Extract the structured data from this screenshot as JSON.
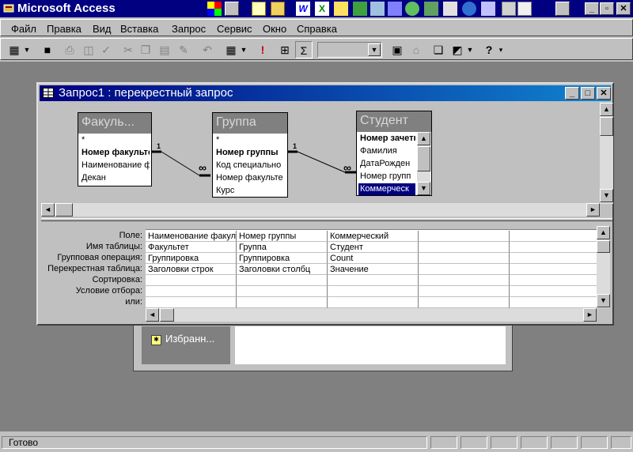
{
  "app": {
    "title": "Microsoft Access"
  },
  "menu": [
    "Файл",
    "Правка",
    "Вид",
    "Вставка",
    "Запрос",
    "Сервис",
    "Окно",
    "Справка"
  ],
  "query_window": {
    "title": "Запрос1 : перекрестный запрос",
    "tables": [
      {
        "name": "Факуль...",
        "fields": [
          "*",
          "Номер факульте",
          "Наименование ф",
          "Декан"
        ]
      },
      {
        "name": "Группа",
        "fields": [
          "*",
          "Номер группы",
          "Код специально",
          "Номер факульте",
          "Курс"
        ]
      },
      {
        "name": "Студент",
        "fields": [
          "Номер зачетн",
          "Фамилия",
          "ДатаРожден",
          "Номер групп",
          "Коммерческ"
        ]
      }
    ],
    "relations": [
      {
        "one": "1",
        "many": "∞"
      },
      {
        "one": "1",
        "many": "∞"
      }
    ],
    "grid_labels": [
      "Поле:",
      "Имя таблицы:",
      "Групповая операция:",
      "Перекрестная таблица:",
      "Сортировка:",
      "Условие отбора:",
      "или:"
    ],
    "grid_columns": [
      [
        "Наименование факуль",
        "Факультет",
        "Группировка",
        "Заголовки строк",
        "",
        "",
        ""
      ],
      [
        "Номер группы",
        "Группа",
        "Группировка",
        "Заголовки столбц",
        "",
        "",
        ""
      ],
      [
        "Коммерческий",
        "Студент",
        "Count",
        "Значение",
        "",
        "",
        ""
      ],
      [
        "",
        "",
        "",
        "",
        "",
        "",
        ""
      ],
      [
        "",
        "",
        "",
        "",
        "",
        "",
        ""
      ]
    ]
  },
  "db_window": {
    "item": "Избранн..."
  },
  "status": {
    "text": "Готово"
  }
}
